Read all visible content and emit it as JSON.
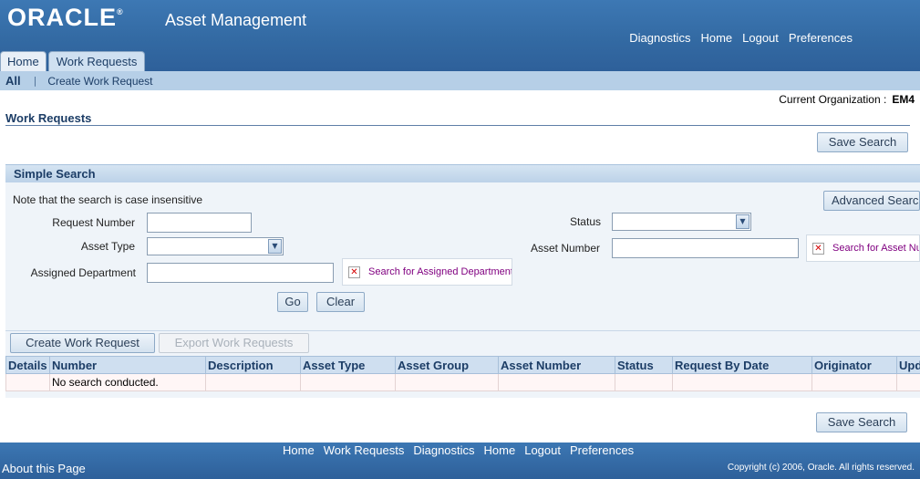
{
  "header": {
    "brand": "ORACLE",
    "brand_mark": "®",
    "app_name": "Asset Management",
    "global_links": [
      "Diagnostics",
      "Home",
      "Logout",
      "Preferences"
    ]
  },
  "tabs": [
    {
      "label": "Home",
      "active": false
    },
    {
      "label": "Work Requests",
      "active": true
    }
  ],
  "subtabs": {
    "all": "All",
    "separator": "|",
    "create": "Create Work Request"
  },
  "organization": {
    "label": "Current Organization :",
    "value": "EM4"
  },
  "page": {
    "title": "Work Requests",
    "save_search_top": "Save Search",
    "save_search_bottom": "Save Search"
  },
  "simple_search": {
    "title": "Simple Search",
    "note": "Note that the search is case insensitive",
    "advanced_button": "Advanced Search",
    "request_number_label": "Request Number",
    "request_number_value": "",
    "asset_type_label": "Asset Type",
    "asset_type_value": "",
    "assigned_department_label": "Assigned Department",
    "assigned_department_value": "",
    "assigned_department_lov": "Search for Assigned Department",
    "status_label": "Status",
    "status_value": "",
    "asset_number_label": "Asset Number",
    "asset_number_value": "",
    "asset_number_lov": "Search for Asset Number",
    "go_button": "Go",
    "clear_button": "Clear"
  },
  "results": {
    "create_button": "Create Work Request",
    "export_button": "Export Work Requests",
    "columns": [
      "Details",
      "Number",
      "Description",
      "Asset Type",
      "Asset Group",
      "Asset Number",
      "Status",
      "Request By Date",
      "Originator",
      "Updated"
    ],
    "empty_message": "No search conducted."
  },
  "footer": {
    "links": [
      "Home",
      "Work Requests",
      "Diagnostics",
      "Home",
      "Logout",
      "Preferences"
    ],
    "about": "About this Page",
    "copyright": "Copyright (c) 2006, Oracle. All rights reserved."
  },
  "colors": {
    "brand_blue": "#336aa3",
    "tab_bar": "#b6cfe7",
    "link_purple": "#800080"
  }
}
